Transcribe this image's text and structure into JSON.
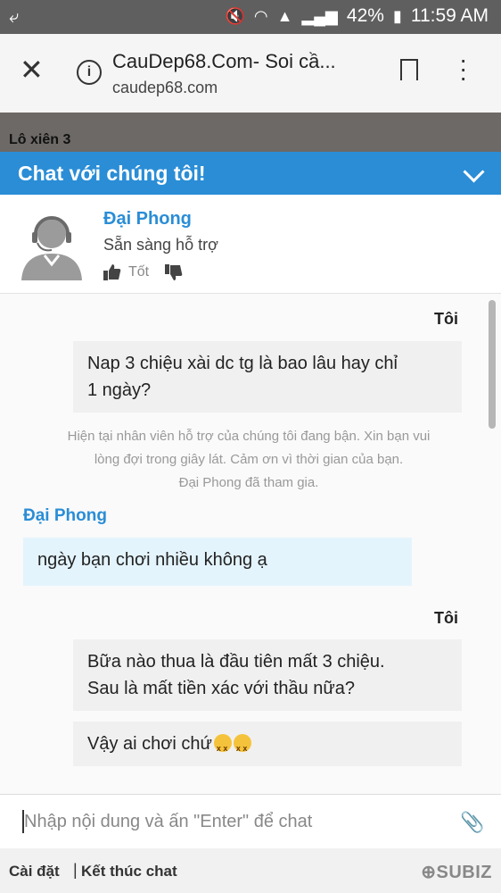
{
  "status_bar": {
    "battery": "42%",
    "time": "11:59 AM"
  },
  "browser": {
    "page_title": "CauDep68.Com- Soi cầ...",
    "url": "caudep68.com"
  },
  "page": {
    "background_heading": "Lô xiên 3"
  },
  "chat": {
    "header_title": "Chat với chúng tôi!",
    "agent": {
      "name": "Đại Phong",
      "status": "Sẵn sàng hỗ trợ",
      "rate_good_label": "Tốt"
    },
    "messages": {
      "me_label_1": "Tôi",
      "me_msg_1_line1": "Nap 3 chiệu xài dc tg là bao lâu hay chỉ",
      "me_msg_1_line2": "1 ngày?",
      "system_line1": "Hiện tại nhân viên hỗ trợ của chúng tôi đang bận. Xin bạn vui",
      "system_line2": "lòng đợi trong giây lát. Cảm ơn vì thời gian của bạn.",
      "joined_notice": "Đại Phong đã tham gia.",
      "agent_label": "Đại Phong",
      "agent_msg_1": "ngày bạn chơi nhiều không ạ",
      "me_label_2": "Tôi",
      "me_msg_2_line1": "Bữa nào thua là đầu tiên mất 3 chiệu.",
      "me_msg_2_line2": "Sau là mất tiền xác với thầu nữa?",
      "me_msg_3": "Vậy ai chơi chứ"
    },
    "input_placeholder": "Nhập nội dung và ấn \"Enter\" để chat",
    "footer": {
      "settings": "Cài đặt",
      "separator": "|",
      "end_chat": "Kết thúc chat",
      "brand": "SUBIZ"
    }
  },
  "colors": {
    "accent": "#2a8dd6",
    "status_bar": "#5f5f5f",
    "agent_bubble": "#e4f4fd",
    "my_bubble": "#f0f0f0"
  }
}
